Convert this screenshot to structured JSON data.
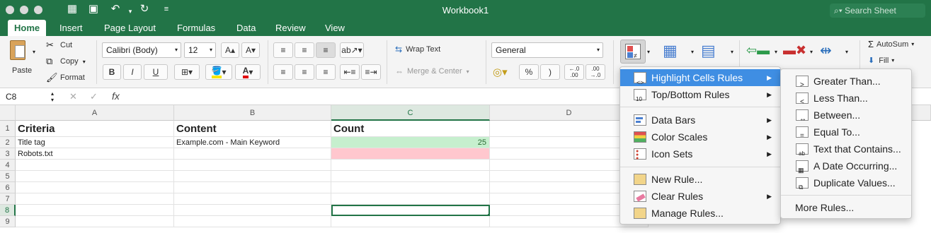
{
  "window": {
    "title": "Workbook1",
    "search_placeholder": "Search Sheet"
  },
  "tabs": [
    "Home",
    "Insert",
    "Page Layout",
    "Formulas",
    "Data",
    "Review",
    "View"
  ],
  "ribbon": {
    "paste": "Paste",
    "cut": "Cut",
    "copy": "Copy",
    "format": "Format",
    "font_name": "Calibri (Body)",
    "font_size": "12",
    "bold": "B",
    "italic": "I",
    "underline": "U",
    "wrap_text": "Wrap Text",
    "merge_center": "Merge & Center",
    "number_format": "General",
    "percent": "%",
    "comma": ")",
    "dec_inc": "←.0 .00",
    "dec_dec": ".00 →.0",
    "autosum": "AutoSum",
    "fill": "Fill"
  },
  "formula_bar": {
    "name_box": "C8",
    "fx": "fx"
  },
  "sheet": {
    "columns": [
      "A",
      "B",
      "C",
      "D"
    ],
    "rows": [
      "1",
      "2",
      "3",
      "4",
      "5",
      "6",
      "7",
      "8",
      "9"
    ],
    "cells": {
      "A1": "Criteria",
      "B1": "Content",
      "C1": "Count",
      "A2": "Title tag",
      "B2": "Example.com - Main Keyword",
      "C2": "25",
      "A3": "Robots.txt"
    },
    "colors": {
      "green_fill": "#c6efce",
      "red_fill": "#ffc7ce",
      "accent": "#227447",
      "menu_highlight": "#3f8ee3"
    }
  },
  "cf_menu": {
    "items": [
      "Highlight Cells Rules",
      "Top/Bottom Rules",
      "Data Bars",
      "Color Scales",
      "Icon Sets",
      "New Rule...",
      "Clear Rules",
      "Manage Rules..."
    ]
  },
  "sub_menu": {
    "items": [
      "Greater Than...",
      "Less Than...",
      "Between...",
      "Equal To...",
      "Text that Contains...",
      "A Date Occurring...",
      "Duplicate Values...",
      "More Rules..."
    ]
  }
}
